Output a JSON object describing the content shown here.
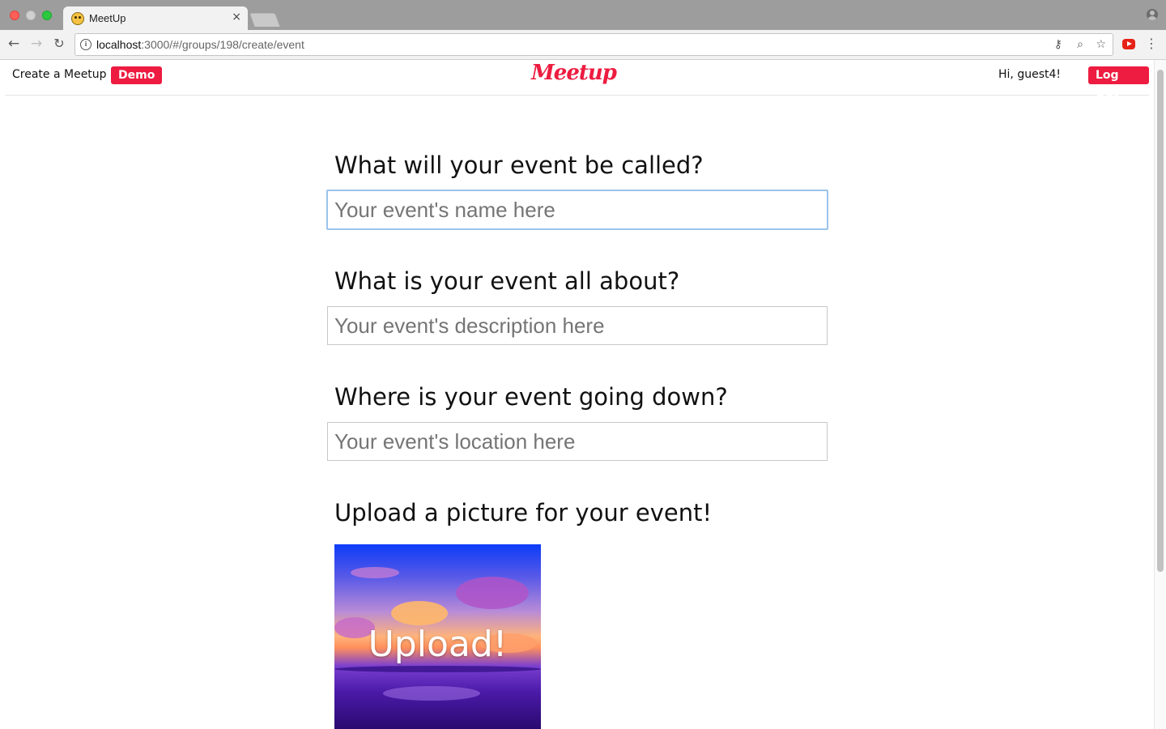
{
  "browser": {
    "tab_title": "MeetUp",
    "tab_close": "×",
    "url_host": "localhost",
    "url_rest": ":3000/#/groups/198/create/event"
  },
  "header": {
    "create_link": "Create a Meetup",
    "demo_button": "Demo",
    "logo": "Meetup",
    "greeting": "Hi, guest4!",
    "logout_button": "Log Out"
  },
  "form": {
    "name_question": "What will your event be called?",
    "name_placeholder": "Your event's name here",
    "description_question": "What is your event all about?",
    "description_placeholder": "Your event's description here",
    "location_question": "Where is your event going down?",
    "location_placeholder": "Your event's location here",
    "upload_question": "Upload a picture for your event!",
    "upload_label": "Upload!"
  },
  "colors": {
    "brand_red": "#ed1c40",
    "focus_border": "#9ac4ec"
  }
}
